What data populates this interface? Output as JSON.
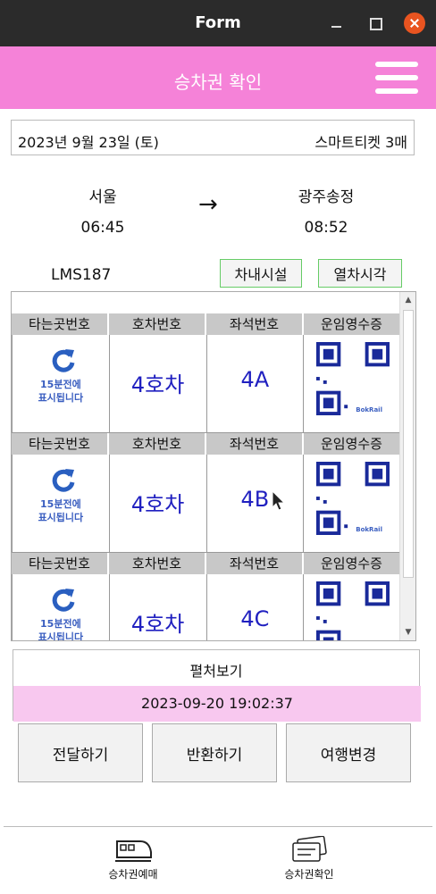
{
  "window": {
    "title": "Form"
  },
  "header": {
    "title": "승차권 확인"
  },
  "trip": {
    "date": "2023년 9월 23일 (토)",
    "ticket_type": "스마트티켓 3매",
    "from": {
      "station": "서울",
      "time": "06:45"
    },
    "arrow": "→",
    "to": {
      "station": "광주송정",
      "time": "08:52"
    },
    "train_number": "LMS187"
  },
  "buttons": {
    "facilities": "차내시설",
    "timetable": "열차시각"
  },
  "table": {
    "headers": [
      "타는곳번호",
      "호차번호",
      "좌석번호",
      "운임영수증"
    ],
    "platform_notice": [
      "15분전에",
      "표시됩니다"
    ],
    "qr_brand": "BokRail",
    "rows": [
      {
        "car": "4호차",
        "seat": "4A"
      },
      {
        "car": "4호차",
        "seat": "4B"
      },
      {
        "car": "4호차",
        "seat": "4C"
      }
    ]
  },
  "view_panel": {
    "title": "펼처보기",
    "datetime": "2023-09-20 19:02:37"
  },
  "actions": {
    "transfer": "전달하기",
    "refund": "반환하기",
    "change": "여행변경"
  },
  "nav": {
    "booking": "승차권예매",
    "confirm": "승차권확인"
  },
  "colors": {
    "header": "#f582d8",
    "highlight": "#f8c8ef",
    "seat_text": "#2020c0",
    "close_button": "#e95420"
  }
}
